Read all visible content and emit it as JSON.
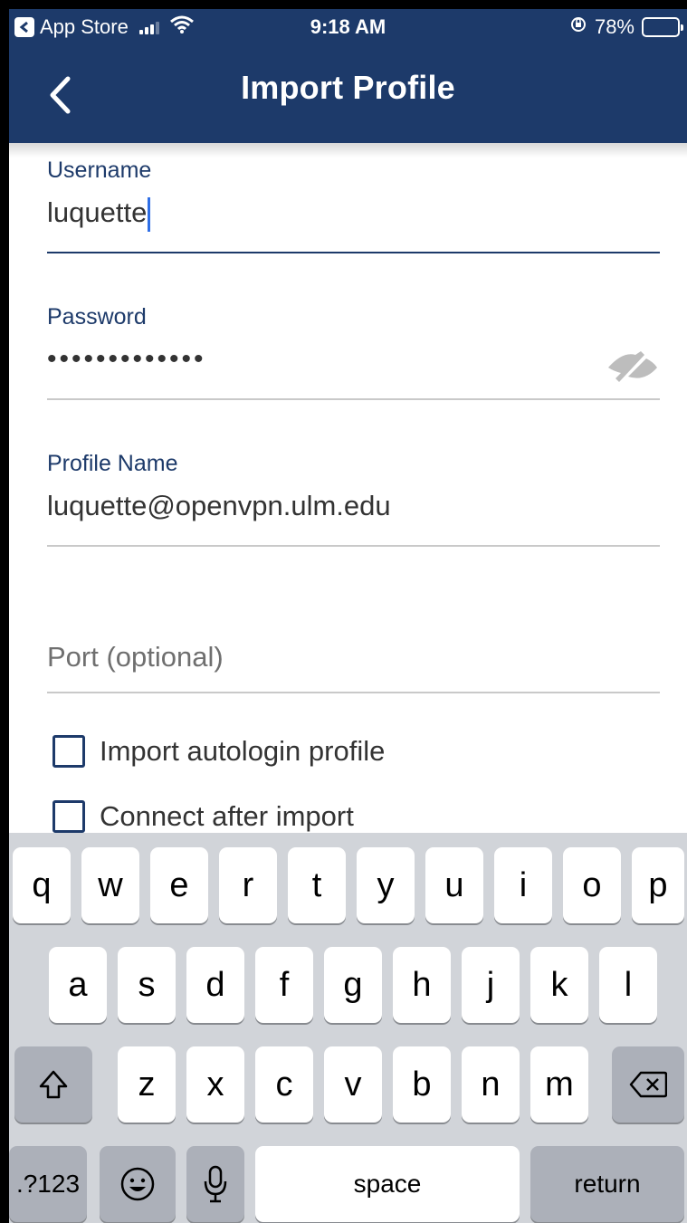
{
  "status_bar": {
    "back_app": "App Store",
    "time": "9:18 AM",
    "battery_text": "78%",
    "battery_level": 0.78,
    "battery_color": "#f6c300"
  },
  "header": {
    "title": "Import Profile",
    "back_icon": "chevron-left-icon",
    "background": "#1d3a6a"
  },
  "form": {
    "username": {
      "label": "Username",
      "value": "luquette"
    },
    "password": {
      "label": "Password",
      "value": "•••••••••••••",
      "toggle_icon": "eye-slash-icon"
    },
    "profile_name": {
      "label": "Profile Name",
      "value": "luquette@openvpn.ulm.edu"
    },
    "port": {
      "placeholder": "Port (optional)"
    },
    "checkboxes": [
      {
        "label": "Import autologin profile",
        "checked": false
      },
      {
        "label": "Connect after import",
        "checked": false
      }
    ]
  },
  "keyboard": {
    "row1": [
      "q",
      "w",
      "e",
      "r",
      "t",
      "y",
      "u",
      "i",
      "o",
      "p"
    ],
    "row2": [
      "a",
      "s",
      "d",
      "f",
      "g",
      "h",
      "j",
      "k",
      "l"
    ],
    "row3": [
      "z",
      "x",
      "c",
      "v",
      "b",
      "n",
      "m"
    ],
    "numbers_label": ".?123",
    "space_label": "space",
    "return_label": "return",
    "shift_icon": "shift-icon",
    "delete_icon": "backspace-icon",
    "emoji_icon": "emoji-icon",
    "mic_icon": "microphone-icon"
  }
}
